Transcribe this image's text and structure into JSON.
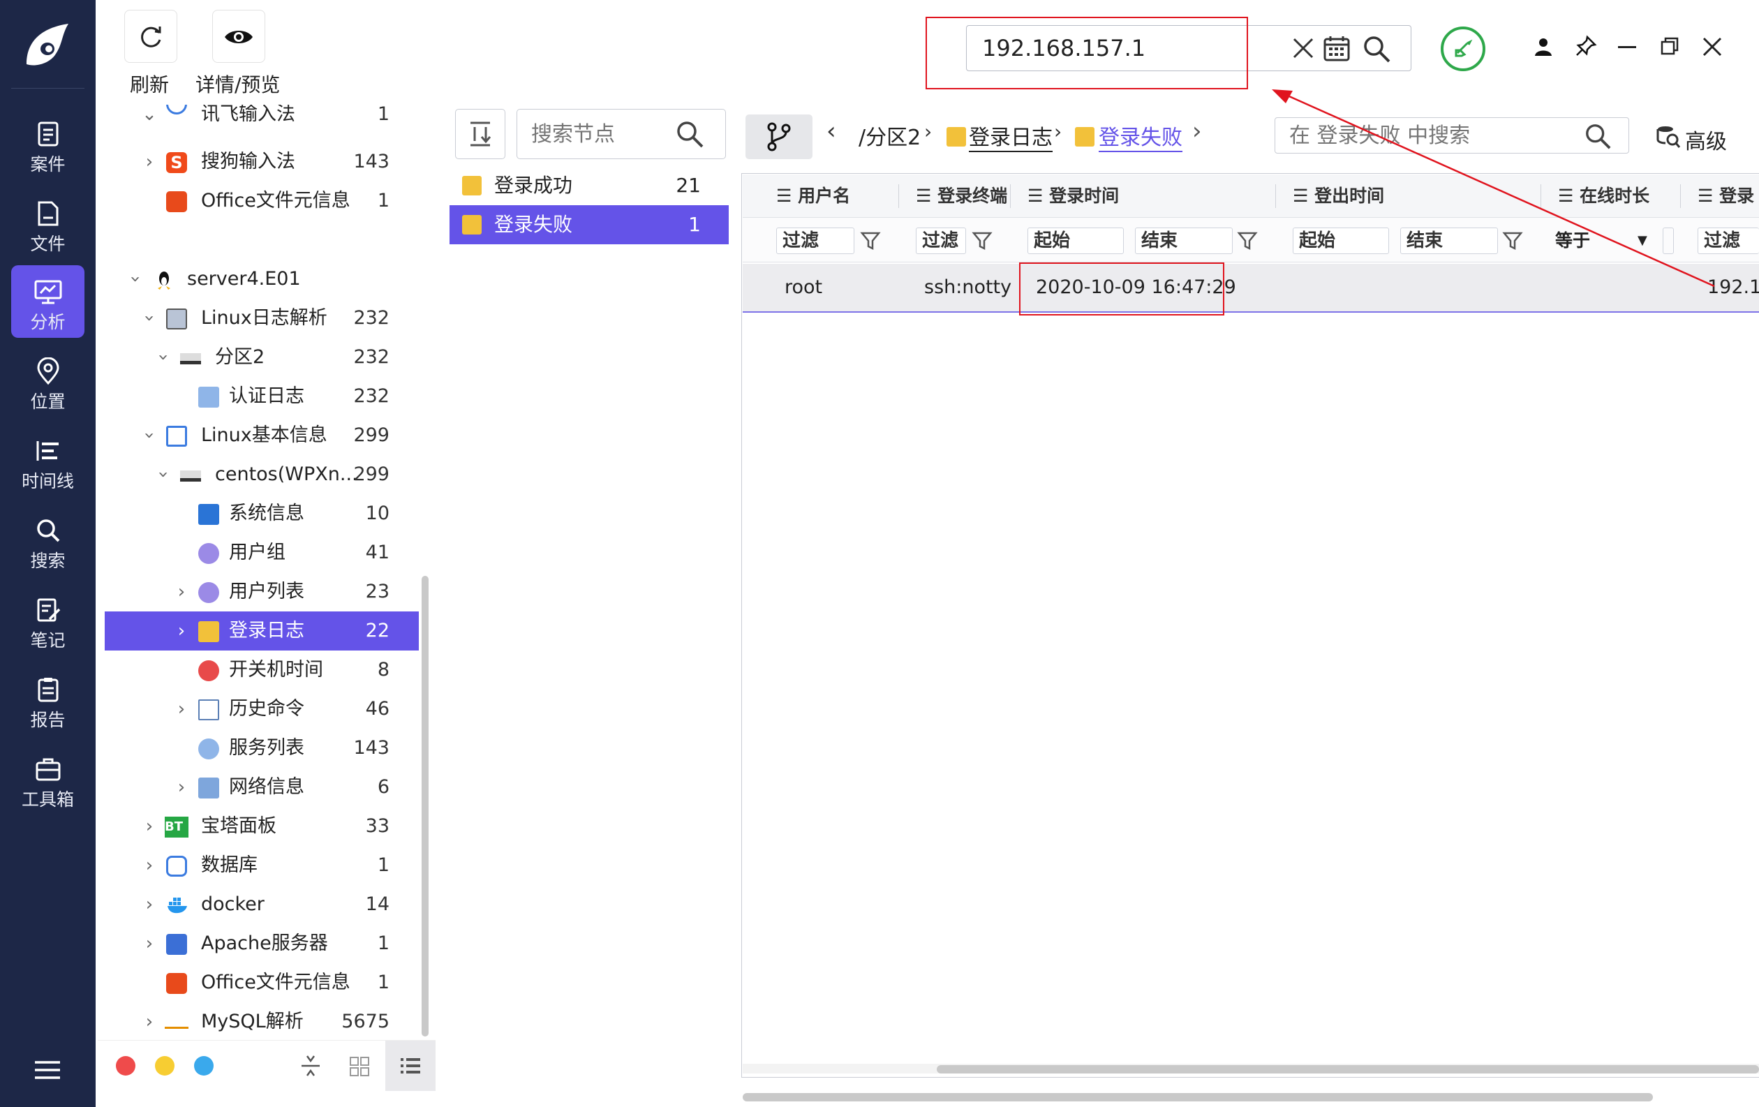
{
  "nav": {
    "items": [
      {
        "label": "案件",
        "icon": "case-icon"
      },
      {
        "label": "文件",
        "icon": "file-icon"
      },
      {
        "label": "分析",
        "icon": "analysis-icon",
        "active": true
      },
      {
        "label": "位置",
        "icon": "location-icon"
      },
      {
        "label": "时间线",
        "icon": "timeline-icon"
      },
      {
        "label": "搜索",
        "icon": "search-icon"
      },
      {
        "label": "笔记",
        "icon": "note-icon"
      },
      {
        "label": "报告",
        "icon": "report-icon"
      },
      {
        "label": "工具箱",
        "icon": "toolbox-icon"
      }
    ]
  },
  "toolbar": {
    "refresh_label": "刷新",
    "detail_label": "详情/预览"
  },
  "global_search": {
    "value": "192.168.157.1"
  },
  "tree": {
    "rows": [
      {
        "label": "讯飞输入法",
        "count": "1"
      },
      {
        "label": "搜狗输入法",
        "count": "143"
      },
      {
        "label": "Office文件元信息",
        "count": "1"
      },
      {
        "label": "server4.E01",
        "count": ""
      },
      {
        "label": "Linux日志解析",
        "count": "232"
      },
      {
        "label": "分区2",
        "count": "232"
      },
      {
        "label": "认证日志",
        "count": "232"
      },
      {
        "label": "Linux基本信息",
        "count": "299"
      },
      {
        "label": "centos(WPXn...",
        "count": "299"
      },
      {
        "label": "系统信息",
        "count": "10"
      },
      {
        "label": "用户组",
        "count": "41"
      },
      {
        "label": "用户列表",
        "count": "23"
      },
      {
        "label": "登录日志",
        "count": "22"
      },
      {
        "label": "开关机时间",
        "count": "8"
      },
      {
        "label": "历史命令",
        "count": "46"
      },
      {
        "label": "服务列表",
        "count": "143"
      },
      {
        "label": "网络信息",
        "count": "6"
      },
      {
        "label": "宝塔面板",
        "count": "33"
      },
      {
        "label": "数据库",
        "count": "1"
      },
      {
        "label": "docker",
        "count": "14"
      },
      {
        "label": "Apache服务器",
        "count": "1"
      },
      {
        "label": "Office文件元信息",
        "count": "1"
      },
      {
        "label": "MySQL解析",
        "count": "5675"
      }
    ]
  },
  "node_search": {
    "placeholder": "搜索节点"
  },
  "node_list": [
    {
      "label": "登录成功",
      "count": "21"
    },
    {
      "label": "登录失败",
      "count": "1"
    }
  ],
  "breadcrumb": {
    "part1": "/分区2",
    "part2": "登录日志",
    "part3": "登录失败"
  },
  "table_search": {
    "placeholder": "在 登录失败 中搜索"
  },
  "advanced_label": "高级",
  "table": {
    "headers": [
      "用户名",
      "登录终端",
      "登录时间",
      "登出时间",
      "在线时长",
      "登录"
    ],
    "filters": {
      "filter": "过滤",
      "start": "起始",
      "end": "结束",
      "equals": "等于"
    },
    "rows": [
      {
        "user": "root",
        "terminal": "ssh:notty",
        "login_time": "2020-10-09 16:47:29",
        "ip": "192.1"
      }
    ]
  },
  "colors": {
    "nav_bg": "#1d2747",
    "accent": "#6453e8",
    "highlight_red": "#e0141e"
  }
}
